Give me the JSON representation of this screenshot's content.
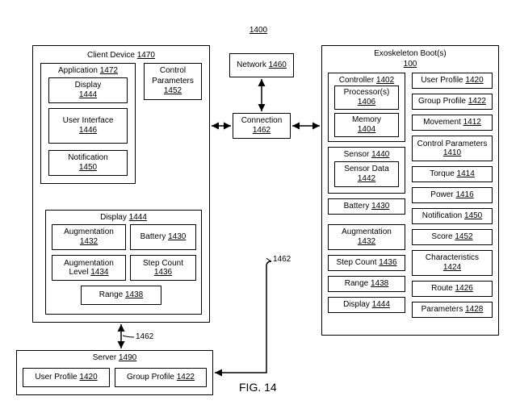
{
  "fig": {
    "num": "1400",
    "caption": "FIG. 14"
  },
  "network": {
    "label": "Network",
    "ref": "1460"
  },
  "connection": {
    "label": "Connection",
    "ref": "1462"
  },
  "conn_ref_a": "1462",
  "conn_ref_b": "1462",
  "client": {
    "label": "Client Device",
    "ref": "1470",
    "application": {
      "label": "Application",
      "ref": "1472",
      "display": {
        "label": "Display",
        "ref": "1444"
      },
      "ui": {
        "label": "User Interface",
        "ref": "1446"
      },
      "notification": {
        "label": "Notification",
        "ref": "1450"
      }
    },
    "control_params": {
      "label": "Control Parameters",
      "ref": "1452"
    },
    "display_panel": {
      "label": "Display",
      "ref": "1444",
      "augmentation": {
        "label": "Augmentation",
        "ref": "1432"
      },
      "battery": {
        "label": "Battery",
        "ref": "1430"
      },
      "aug_level": {
        "label": "Augmentation Level",
        "ref": "1434"
      },
      "step_count": {
        "label": "Step Count",
        "ref": "1436"
      },
      "range": {
        "label": "Range",
        "ref": "1438"
      }
    }
  },
  "server": {
    "label": "Server",
    "ref": "1490",
    "user_profile": {
      "label": "User Profile",
      "ref": "1420"
    },
    "group_profile": {
      "label": "Group Profile",
      "ref": "1422"
    }
  },
  "exo": {
    "label": "Exoskeleton Boot(s)",
    "ref": "100",
    "controller": {
      "label": "Controller",
      "ref": "1402",
      "processor": {
        "label": "Processor(s)",
        "ref": "1406"
      },
      "memory": {
        "label": "Memory",
        "ref": "1404"
      }
    },
    "sensor": {
      "label": "Sensor",
      "ref": "1440",
      "data": {
        "label": "Sensor Data",
        "ref": "1442"
      }
    },
    "battery": {
      "label": "Battery",
      "ref": "1430"
    },
    "augmentation": {
      "label": "Augmentation",
      "ref": "1432"
    },
    "step_count": {
      "label": "Step Count",
      "ref": "1436"
    },
    "range": {
      "label": "Range",
      "ref": "1438"
    },
    "display": {
      "label": "Display",
      "ref": "1444"
    },
    "user_profile": {
      "label": "User Profile",
      "ref": "1420"
    },
    "group_profile": {
      "label": "Group Profile",
      "ref": "1422"
    },
    "movement": {
      "label": "Movement",
      "ref": "1412"
    },
    "control_params": {
      "label": "Control Parameters",
      "ref": "1410"
    },
    "torque": {
      "label": "Torque",
      "ref": "1414"
    },
    "power": {
      "label": "Power",
      "ref": "1416"
    },
    "notification": {
      "label": "Notification",
      "ref": "1450"
    },
    "score": {
      "label": "Score",
      "ref": "1452"
    },
    "characteristics": {
      "label": "Characteristics",
      "ref": "1424"
    },
    "route": {
      "label": "Route",
      "ref": "1426"
    },
    "parameters": {
      "label": "Parameters",
      "ref": "1428"
    }
  }
}
